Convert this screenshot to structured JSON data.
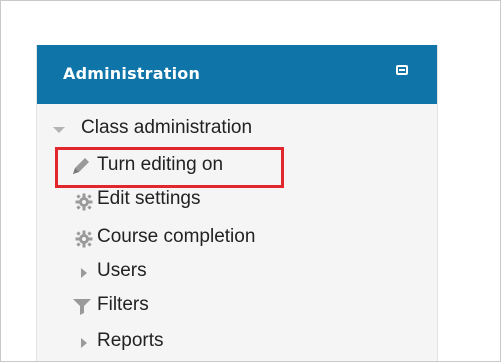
{
  "block": {
    "title": "Administration",
    "collapse_icon": "collapse-square-icon"
  },
  "tree": {
    "root": {
      "label": "Class administration",
      "icon": "caret-down-icon"
    },
    "items": [
      {
        "label": "Turn editing on",
        "icon": "pencil-icon"
      },
      {
        "label": "Edit settings",
        "icon": "gear-icon"
      },
      {
        "label": "Course completion",
        "icon": "gear-icon"
      },
      {
        "label": "Users",
        "icon": "caret-right-icon"
      },
      {
        "label": "Filters",
        "icon": "filter-icon"
      },
      {
        "label": "Reports",
        "icon": "caret-right-icon"
      }
    ]
  },
  "colors": {
    "header_bg": "#0f74a8",
    "panel_bg": "#f5f5f5",
    "highlight": "#e2262d"
  }
}
